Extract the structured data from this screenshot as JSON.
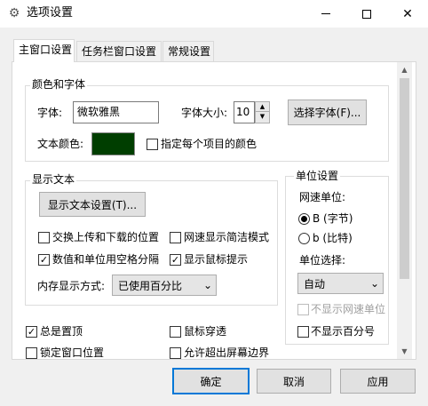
{
  "window": {
    "title": "选项设置",
    "icon": "gear-icon"
  },
  "tabs": [
    {
      "label": "主窗口设置",
      "active": true
    },
    {
      "label": "任务栏窗口设置",
      "active": false
    },
    {
      "label": "常规设置",
      "active": false
    }
  ],
  "color_font": {
    "group_label": "颜色和字体",
    "font_label": "字体:",
    "font_value": "微软雅黑",
    "font_size_label": "字体大小:",
    "font_size_value": "10",
    "select_font_button": "选择字体(F)...",
    "text_color_label": "文本颜色:",
    "text_color": "#003e00",
    "per_item_color_label": "指定每个项目的颜色",
    "per_item_color_checked": false
  },
  "display_text": {
    "group_label": "显示文本",
    "settings_button": "显示文本设置(T)...",
    "swap_updown_label": "交换上传和下载的位置",
    "swap_updown_checked": false,
    "simple_mode_label": "网速显示简洁模式",
    "simple_mode_checked": false,
    "space_separate_label": "数值和单位用空格分隔",
    "space_separate_checked": true,
    "mouse_tip_label": "显示鼠标提示",
    "mouse_tip_checked": true,
    "memory_mode_label": "内存显示方式:",
    "memory_mode_value": "已使用百分比"
  },
  "unit": {
    "group_label": "单位设置",
    "speed_unit_label": "网速单位:",
    "radio_byte_label": "B (字节)",
    "radio_byte_selected": true,
    "radio_bit_label": "b (比特)",
    "radio_bit_selected": false,
    "unit_select_label": "单位选择:",
    "unit_select_value": "自动",
    "hide_speed_unit_label": "不显示网速单位",
    "hide_speed_unit_checked": false,
    "hide_percent_label": "不显示百分号",
    "hide_percent_checked": false
  },
  "bottom": {
    "always_on_top_label": "总是置顶",
    "always_on_top_checked": true,
    "mouse_through_label": "鼠标穿透",
    "mouse_through_checked": false,
    "lock_position_label": "锁定窗口位置",
    "lock_position_checked": false,
    "allow_outside_label": "允许超出屏幕边界",
    "allow_outside_checked": false
  },
  "buttons": {
    "ok": "确定",
    "cancel": "取消",
    "apply": "应用"
  },
  "icons": {
    "check": "✓",
    "scroll_up": "▲",
    "scroll_down": "▼",
    "spin_up": "▲",
    "spin_down": "▼",
    "dropdown": "⌄",
    "close": "✕"
  }
}
